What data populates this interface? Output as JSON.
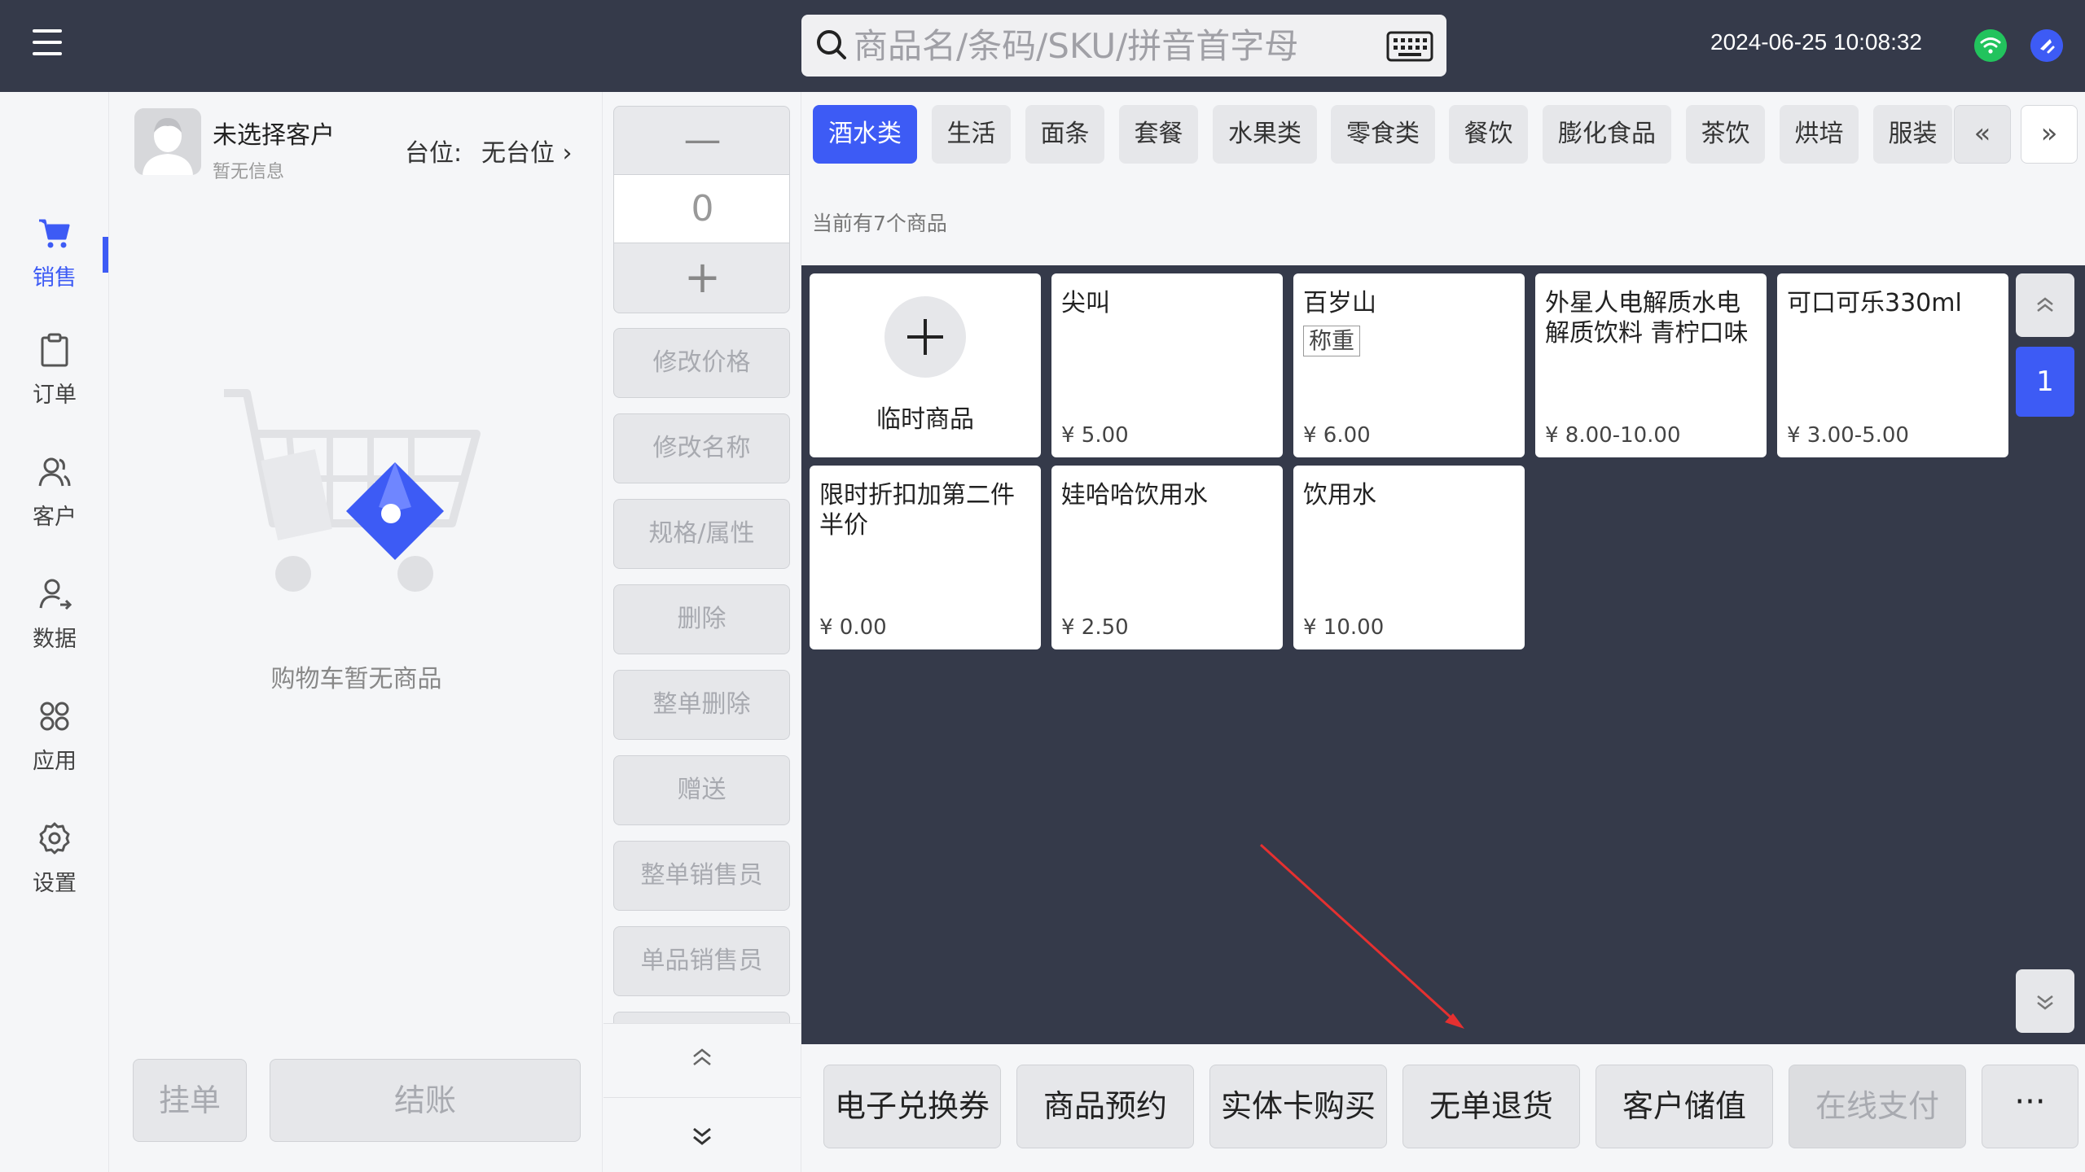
{
  "topbar": {
    "search_placeholder": "商品名/条码/SKU/拼音首字母",
    "datetime": "2024-06-25 10:08:32"
  },
  "nav": {
    "items": [
      {
        "label": "销售",
        "icon": "cart-icon"
      },
      {
        "label": "订单",
        "icon": "clipboard-icon"
      },
      {
        "label": "客户",
        "icon": "users-icon"
      },
      {
        "label": "数据",
        "icon": "user-data-icon"
      },
      {
        "label": "应用",
        "icon": "apps-grid-icon"
      },
      {
        "label": "设置",
        "icon": "gear-icon"
      }
    ]
  },
  "cart": {
    "customer_name": "未选择客户",
    "customer_info": "暂无信息",
    "table_label": "台位:",
    "table_value": "无台位 ›",
    "empty_text": "购物车暂无商品",
    "hold_label": "挂单",
    "checkout_label": "结账"
  },
  "actions": {
    "minus": "—",
    "quantity": "0",
    "plus": "+",
    "buttons": [
      "修改价格",
      "修改名称",
      "规格/属性",
      "删除",
      "整单删除",
      "赠送",
      "整单销售员",
      "单品销售员"
    ]
  },
  "categories": {
    "items": [
      "酒水类",
      "生活",
      "面条",
      "套餐",
      "水果类",
      "零食类",
      "餐饮",
      "膨化食品",
      "茶饮",
      "烘培",
      "服装"
    ],
    "active_index": 0,
    "prev": "«",
    "next": "»"
  },
  "product_count_text": "当前有7个商品",
  "products": {
    "temp": {
      "label": "临时商品"
    },
    "items": [
      {
        "name": "尖叫",
        "tag": "",
        "price": "¥ 5.00"
      },
      {
        "name": "百岁山",
        "tag": "称重",
        "price": "¥ 6.00"
      },
      {
        "name": "外星人电解质水电解质饮料 青柠口味",
        "tag": "",
        "price": "¥ 8.00-10.00"
      },
      {
        "name": "可口可乐330ml",
        "tag": "",
        "price": "¥ 3.00-5.00"
      },
      {
        "name": "限时折扣加第二件半价",
        "tag": "",
        "price": "¥ 0.00"
      },
      {
        "name": "娃哈哈饮用水",
        "tag": "",
        "price": "¥ 2.50"
      },
      {
        "name": "饮用水",
        "tag": "",
        "price": "¥ 10.00"
      }
    ]
  },
  "pagination": {
    "current": "1"
  },
  "bottom_buttons": [
    "电子兑换券",
    "商品预约",
    "实体卡购买",
    "无单退货",
    "客户储值",
    "在线支付"
  ],
  "bottom_more": "···",
  "colors": {
    "primary": "#3d5bf5",
    "topbar": "#353a4a",
    "grid_bg": "#353a4a",
    "wifi": "#22c35d",
    "annotation": "#e53030"
  }
}
